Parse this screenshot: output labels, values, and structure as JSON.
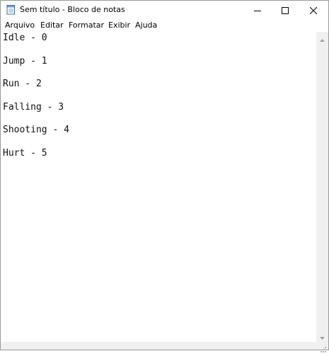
{
  "window": {
    "title": "Sem título - Bloco de notas"
  },
  "icons": {
    "app": "notepad-icon",
    "minimize": "minimize-icon",
    "maximize": "maximize-icon",
    "close": "close-icon",
    "scroll_up": "scroll-up-arrow-icon",
    "scroll_down": "scroll-down-arrow-icon",
    "resize": "resize-grip-icon"
  },
  "menu": {
    "items": [
      {
        "label": "Arquivo"
      },
      {
        "label": "Editar"
      },
      {
        "label": "Formatar"
      },
      {
        "label": "Exibir"
      },
      {
        "label": "Ajuda"
      }
    ]
  },
  "editor": {
    "lines": [
      "Idle - 0",
      "Jump - 1",
      "Run - 2",
      "Falling - 3",
      "Shooting - 4",
      "Hurt - 5"
    ]
  }
}
